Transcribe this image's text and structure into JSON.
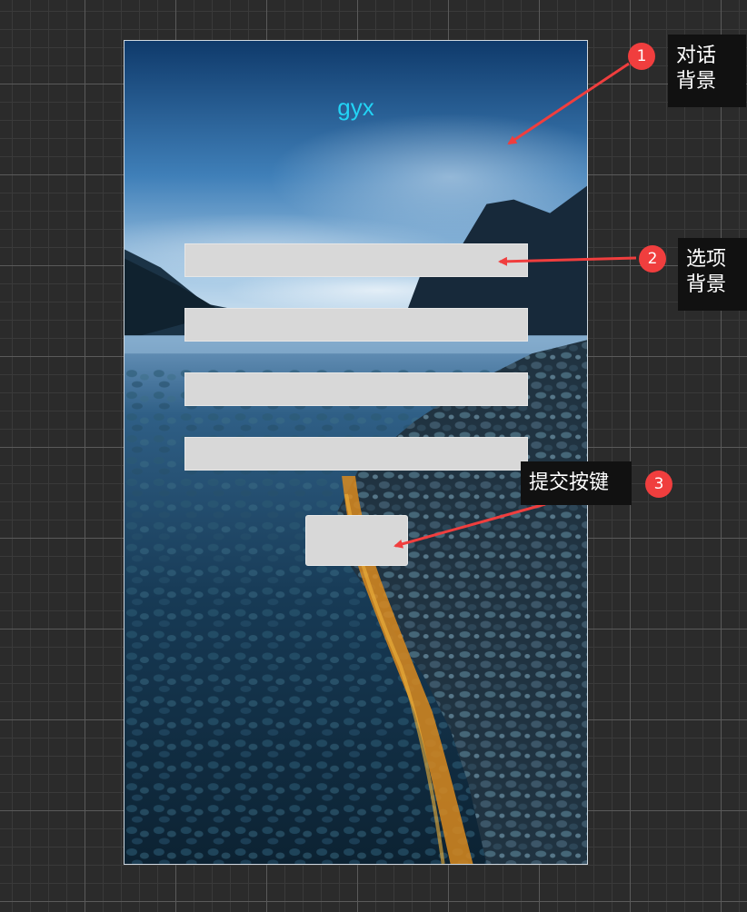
{
  "dialog": {
    "title": "gyx",
    "option_count": 4,
    "colors": {
      "title": "#22d3f5",
      "option_bg": "#d8d8d8",
      "submit_bg": "#d8d8d8"
    }
  },
  "annotations": [
    {
      "number": "1",
      "line1": "对话",
      "line2": "背景"
    },
    {
      "number": "2",
      "line1": "选项",
      "line2": "背景"
    },
    {
      "number": "3",
      "line1": "提交按键",
      "line2": ""
    }
  ],
  "colors": {
    "canvas_bg": "#2b2b2b",
    "arrow": "#f03e3e",
    "badge": "#f03e3e",
    "callout_bg": "#111111"
  }
}
